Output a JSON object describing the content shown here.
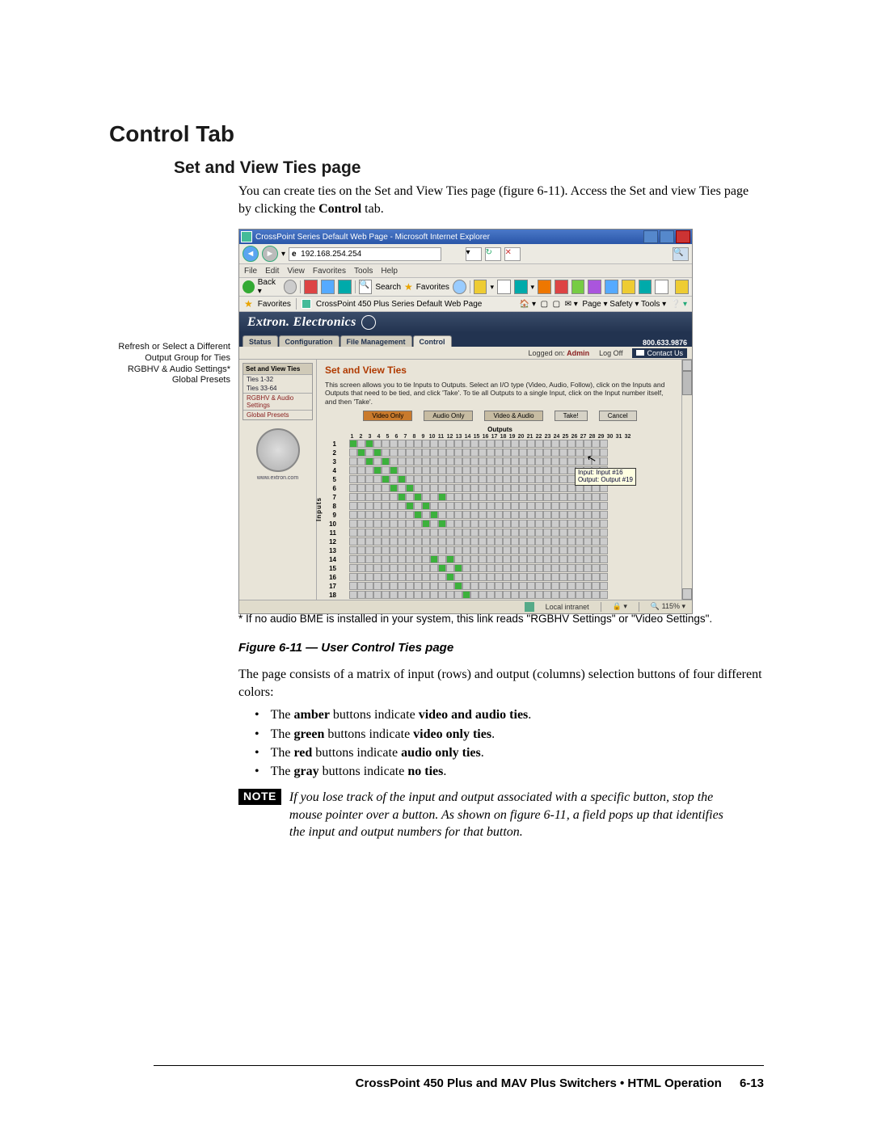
{
  "headings": {
    "h1": "Control Tab",
    "h2": "Set and View Ties page"
  },
  "intro": {
    "line1_a": "You can create ties on the Set and View Ties page (figure 6-11).  Access the Set and view Ties page by clicking the ",
    "line1_b": "Control",
    "line1_c": " tab."
  },
  "callouts": {
    "c1": "Refresh or Select a Different Output Group for Ties",
    "c2": "RGBHV & Audio Settings*",
    "c3": "Global Presets"
  },
  "browser": {
    "title": "CrossPoint Series Default Web Page - Microsoft Internet Explorer",
    "url": "192.168.254.254",
    "menu": [
      "File",
      "Edit",
      "View",
      "Favorites",
      "Tools",
      "Help"
    ],
    "toolbar": {
      "back": "Back",
      "search": "Search",
      "favorites": "Favorites"
    },
    "favrow": {
      "label": "Favorites",
      "page": "CrossPoint 450 Plus Series Default Web Page",
      "right": "Page ▾  Safety ▾  Tools ▾"
    },
    "banner": "Extron. Electronics",
    "tabs": [
      "Status",
      "Configuration",
      "File Management",
      "Control"
    ],
    "phone": "800.633.9876",
    "subbar": {
      "logged": "Logged on:",
      "user": "Admin",
      "logoff": "Log Off",
      "contact": "Contact Us"
    },
    "side": {
      "head": "Set and View Ties",
      "item1": "Ties 1-32",
      "item2": "Ties 33-64",
      "hl": "RGBHV & Audio Settings",
      "gp": "Global Presets",
      "url": "www.extron.com"
    },
    "panel": {
      "title": "Set and View Ties",
      "instr": "This screen allows you to tie Inputs to Outputs. Select an I/O type (Video, Audio, Follow), click on the Inputs and Outputs that need to be tied, and click 'Take'. To tie all Outputs to a single Input, click on the Input number itself, and then 'Take'.",
      "btns": {
        "vo": "Video Only",
        "ao": "Audio Only",
        "fl": "Video & Audio",
        "take": "Take!",
        "cancel": "Cancel"
      },
      "outputs_label": "Outputs",
      "inputs_label": "Inputs",
      "cols": [
        "1",
        "2",
        "3",
        "4",
        "5",
        "6",
        "7",
        "8",
        "9",
        "10",
        "11",
        "12",
        "13",
        "14",
        "15",
        "16",
        "17",
        "18",
        "19",
        "20",
        "21",
        "22",
        "23",
        "24",
        "25",
        "26",
        "27",
        "28",
        "29",
        "30",
        "31",
        "32"
      ],
      "rows": [
        "1",
        "2",
        "3",
        "4",
        "5",
        "6",
        "7",
        "8",
        "9",
        "10",
        "11",
        "12",
        "13",
        "14",
        "15",
        "16",
        "17",
        "18"
      ],
      "tooltip": {
        "l1": "Input: Input #16",
        "l2": "Output: Output #19"
      }
    },
    "status": {
      "zone": "Local intranet",
      "zoom": "115%"
    }
  },
  "footnote": "*  If no audio BME is installed in your system, this link reads \"RGBHV Settings\" or \"Video Settings\".",
  "fig_caption": "Figure 6-11 — User Control Ties page",
  "para2": "The page consists of a matrix of input (rows) and output (columns) selection buttons of four different colors:",
  "bullets": {
    "b1a": "The ",
    "b1b": "amber",
    "b1c": " buttons indicate ",
    "b1d": "video and audio ties",
    "b1e": ".",
    "b2a": "The ",
    "b2b": "green",
    "b2c": " buttons indicate ",
    "b2d": "video only ties",
    "b2e": ".",
    "b3a": "The ",
    "b3b": "red",
    "b3c": " buttons indicate ",
    "b3d": "audio only ties",
    "b3e": ".",
    "b4a": "The ",
    "b4b": "gray",
    "b4c": " buttons indicate ",
    "b4d": "no ties",
    "b4e": "."
  },
  "note": {
    "badge": "NOTE",
    "text": "If you lose track of the input and output associated with a specific button, stop the mouse pointer over a button.  As shown on figure 6-11, a field pops up that identifies the input and output numbers for that button."
  },
  "footer": {
    "text": "CrossPoint 450 Plus and MAV Plus Switchers • HTML Operation",
    "page": "6-13"
  }
}
